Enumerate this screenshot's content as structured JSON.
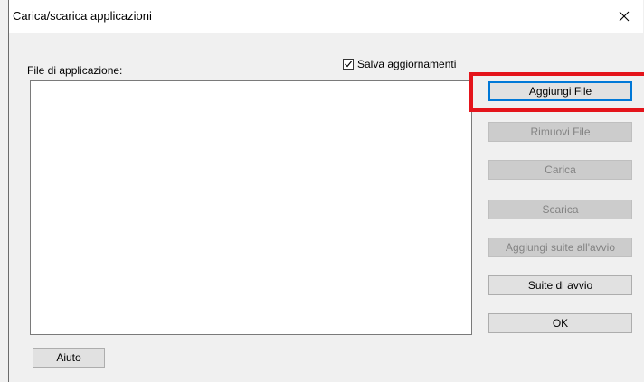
{
  "window": {
    "title": "Carica/scarica applicazioni",
    "close_glyph": "✕"
  },
  "files_label": "File di applicazione:",
  "save_updates": {
    "label": "Salva aggiornamenti",
    "checked": true
  },
  "buttons": {
    "add_file": "Aggiungi File",
    "remove_file": "Rimuovi File",
    "upload": "Carica",
    "download": "Scarica",
    "add_startup_suite": "Aggiungi suite all'avvio",
    "startup_suite": "Suite di avvio",
    "ok": "OK",
    "help": "Aiuto"
  },
  "accent_colors": {
    "highlight": "#e4141b",
    "default_button_border": "#0078d7"
  }
}
